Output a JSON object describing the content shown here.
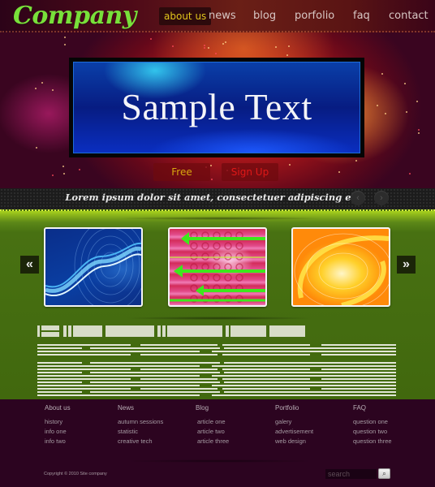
{
  "header": {
    "logo": "Company",
    "nav": [
      {
        "label": "about us",
        "active": true
      },
      {
        "label": "news",
        "active": false
      },
      {
        "label": "blog",
        "active": false
      },
      {
        "label": "porfolio",
        "active": false
      },
      {
        "label": "faq",
        "active": false
      },
      {
        "label": "contact",
        "active": false
      }
    ]
  },
  "hero": {
    "banner_text": "Sample Text",
    "buttons": {
      "free": "Free",
      "signup": "Sign Up"
    }
  },
  "tagbar": {
    "tagline": "Lorem ipsum dolor sit amet, consectetuer adipiscing elit.",
    "prev_icon": "‹",
    "next_icon": "›"
  },
  "gallery": {
    "prev_icon": "«",
    "next_icon": "»",
    "thumbnails": [
      {
        "name": "blue-wave-thumbnail"
      },
      {
        "name": "pink-arrows-thumbnail"
      },
      {
        "name": "orange-swirl-thumbnail"
      }
    ]
  },
  "footer": {
    "columns": [
      {
        "heading": "About us",
        "links": [
          "history",
          "info one",
          "info two"
        ]
      },
      {
        "heading": "News",
        "links": [
          "autumn sessions",
          "statistic",
          "creative tech"
        ]
      },
      {
        "heading": "Blog",
        "links": [
          "article one",
          "article two",
          "article three"
        ]
      },
      {
        "heading": "Portfolio",
        "links": [
          "galery",
          "advertisement",
          "web design"
        ]
      },
      {
        "heading": "FAQ",
        "links": [
          "question one",
          "question two",
          "question three"
        ]
      }
    ],
    "copyright": "Copyright © 2010 Site company",
    "search_placeholder": "search",
    "search_icon": "🔍"
  },
  "colors": {
    "logo_green": "#78e03a",
    "nav_active": "#e0c51c",
    "free_btn": "#d8a80f",
    "signup_btn": "#e01818",
    "green_bg": "#41680e",
    "footer_bg": "#2c0420"
  }
}
